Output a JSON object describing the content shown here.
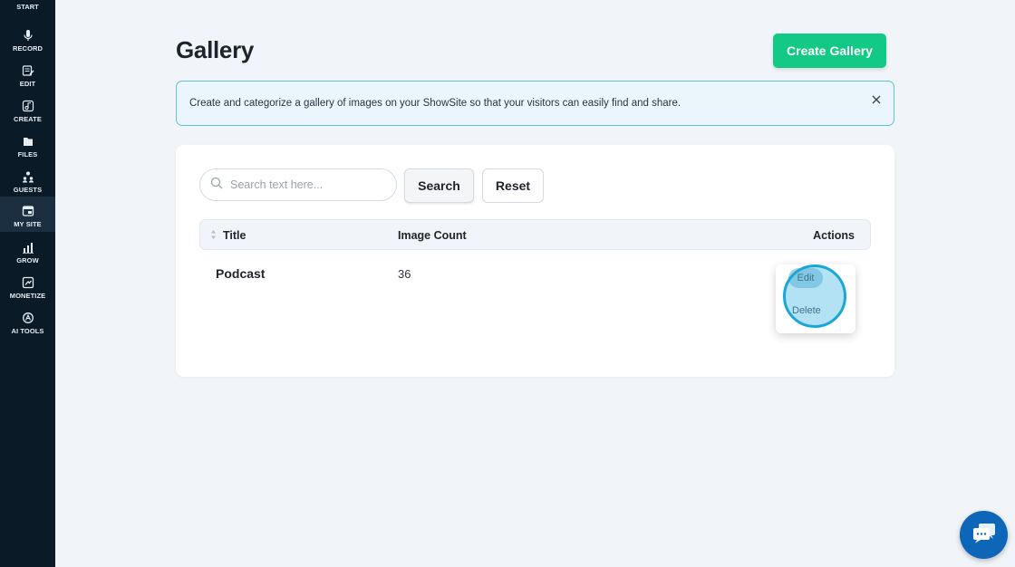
{
  "sidebar": {
    "top_label": "START",
    "items": [
      {
        "label": "RECORD",
        "icon": "microphone-icon"
      },
      {
        "label": "EDIT",
        "icon": "edit-icon"
      },
      {
        "label": "CREATE",
        "icon": "create-icon"
      },
      {
        "label": "FILES",
        "icon": "files-icon"
      },
      {
        "label": "GUESTS",
        "icon": "guests-icon"
      },
      {
        "label": "MY SITE",
        "icon": "site-icon",
        "active": true
      },
      {
        "label": "GROW",
        "icon": "chart-icon"
      },
      {
        "label": "MONETIZE",
        "icon": "monetize-icon"
      },
      {
        "label": "AI TOOLS",
        "icon": "ai-icon"
      }
    ]
  },
  "header": {
    "title": "Gallery",
    "create_label": "Create Gallery"
  },
  "banner": {
    "text": "Create and categorize a gallery of images on your ShowSite so that your visitors can easily find and share."
  },
  "search": {
    "placeholder": "Search text here...",
    "value": "",
    "search_label": "Search",
    "reset_label": "Reset"
  },
  "table": {
    "columns": [
      "Title",
      "Image Count",
      "Actions"
    ],
    "rows": [
      {
        "title": "Podcast",
        "image_count": "36"
      }
    ]
  },
  "menu": {
    "edit_label": "Edit",
    "delete_label": "Delete"
  },
  "colors": {
    "sidebar_bg": "#0b1a27",
    "accent_green": "#12c985",
    "banner_border": "#5fc3d8",
    "chat_blue": "#0e66b8"
  }
}
